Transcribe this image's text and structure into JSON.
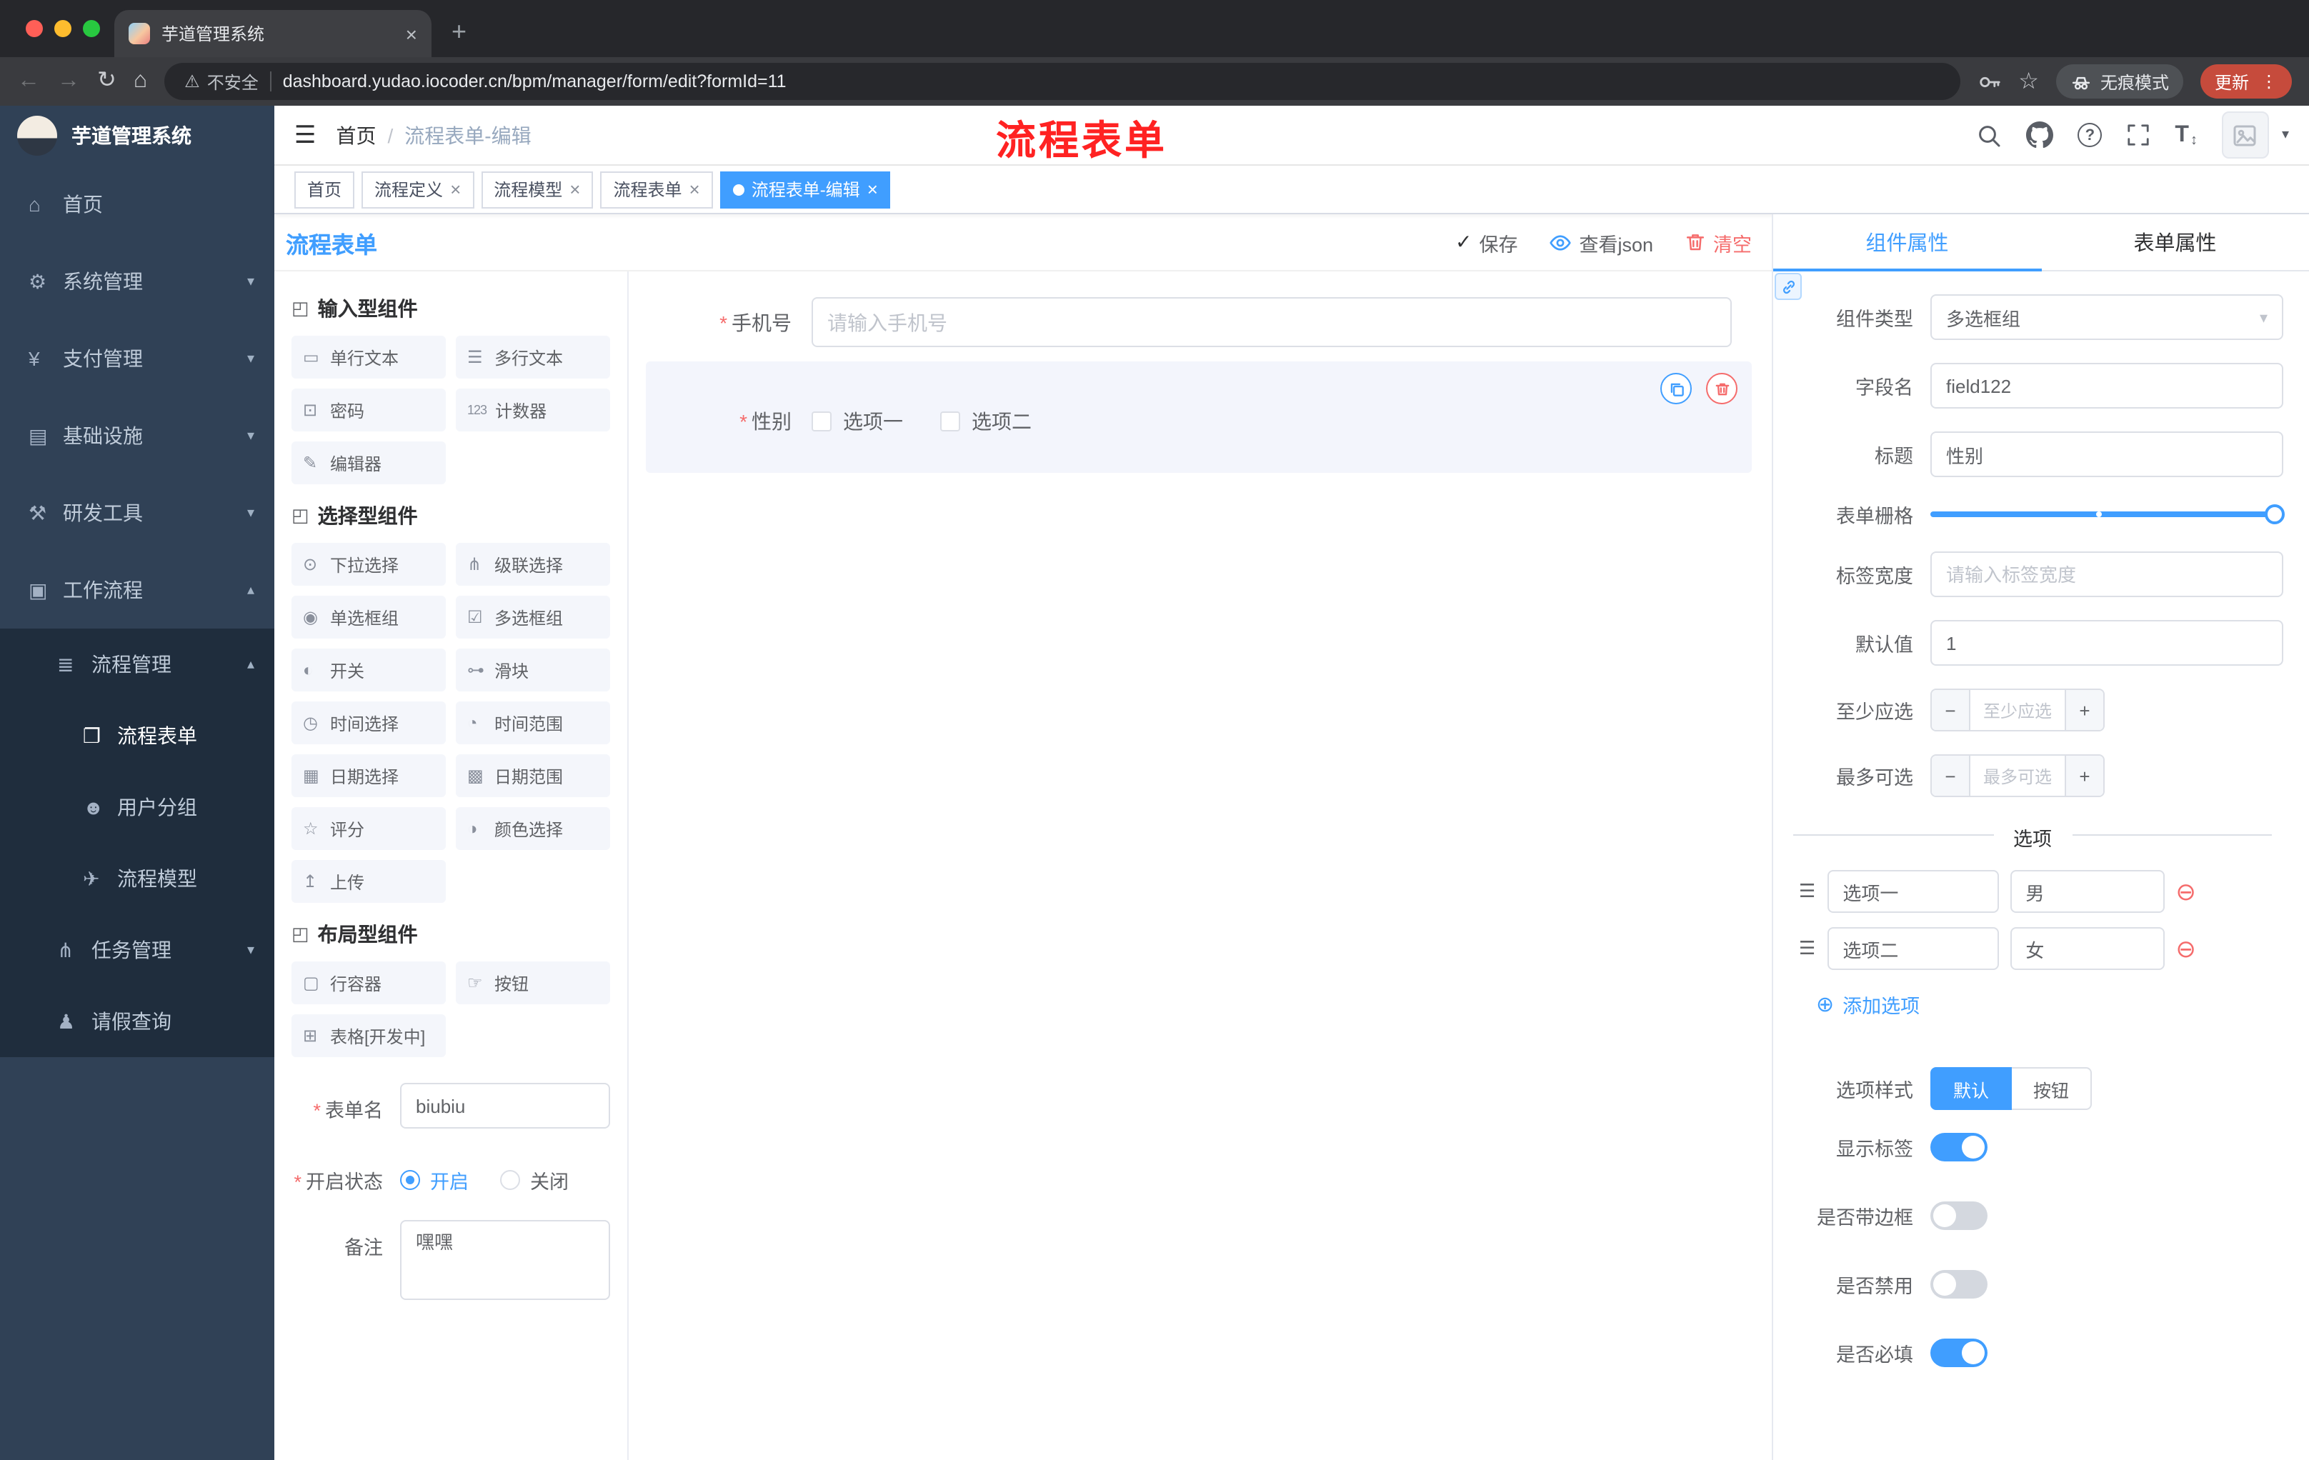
{
  "browser": {
    "tab_title": "芋道管理系统",
    "security_label": "不安全",
    "url": "dashboard.yudao.iocoder.cn/bpm/manager/form/edit?formId=11",
    "incognito_label": "无痕模式",
    "update_label": "更新"
  },
  "icons": {
    "close": "×",
    "plus": "+",
    "minus": "−",
    "back": "←",
    "forward": "→",
    "reload": "↻",
    "home": "⌂",
    "warning": "⚠",
    "star": "☆",
    "dots": "⋮",
    "hamburger": "☰",
    "chevron_down": "▾",
    "caret_down": "▾",
    "check": "✓",
    "question": "?",
    "text_size": "T",
    "text_size_arrows": "↕",
    "group": "◰",
    "required": "*",
    "add_circle": "⊕",
    "remove_circle": "⊖",
    "drag": "☰"
  },
  "sidebar": {
    "logo_title": "芋道管理系统",
    "items": [
      {
        "label": "首页",
        "glyph": "⌂"
      },
      {
        "label": "系统管理",
        "glyph": "⚙",
        "arrow": "▾"
      },
      {
        "label": "支付管理",
        "glyph": "¥",
        "arrow": "▾"
      },
      {
        "label": "基础设施",
        "glyph": "▤",
        "arrow": "▾"
      },
      {
        "label": "研发工具",
        "glyph": "⚒",
        "arrow": "▾"
      },
      {
        "label": "工作流程",
        "glyph": "▣",
        "arrow": "▴"
      },
      {
        "label": "流程管理",
        "glyph": "≣",
        "arrow": "▴"
      },
      {
        "label": "流程表单",
        "glyph": "❐"
      },
      {
        "label": "用户分组",
        "glyph": "☻"
      },
      {
        "label": "流程模型",
        "glyph": "✈"
      },
      {
        "label": "任务管理",
        "glyph": "⋔",
        "arrow": "▾"
      },
      {
        "label": "请假查询",
        "glyph": "♟"
      }
    ]
  },
  "header": {
    "breadcrumb_home": "首页",
    "breadcrumb_sep": "/",
    "breadcrumb_current": "流程表单-编辑",
    "watermark": "流程表单"
  },
  "tags": [
    {
      "label": "首页"
    },
    {
      "label": "流程定义"
    },
    {
      "label": "流程模型"
    },
    {
      "label": "流程表单"
    },
    {
      "label": "流程表单-编辑"
    }
  ],
  "designer": {
    "title": "流程表单",
    "save_label": "保存",
    "view_json_label": "查看json",
    "clear_label": "清空",
    "groups": [
      {
        "title": "输入型组件"
      },
      {
        "title": "选择型组件"
      },
      {
        "title": "布局型组件"
      }
    ],
    "palette1": [
      {
        "label": "单行文本",
        "glyph": "▭"
      },
      {
        "label": "多行文本",
        "glyph": "☰"
      },
      {
        "label": "密码",
        "glyph": "⊡"
      },
      {
        "label": "计数器",
        "glyph": "123"
      },
      {
        "label": "编辑器",
        "glyph": "✎"
      }
    ],
    "palette2": [
      {
        "label": "下拉选择",
        "glyph": "⊙"
      },
      {
        "label": "级联选择",
        "glyph": "⋔"
      },
      {
        "label": "单选框组",
        "glyph": "◉"
      },
      {
        "label": "多选框组",
        "glyph": "☑"
      },
      {
        "label": "开关",
        "glyph": "◐"
      },
      {
        "label": "滑块",
        "glyph": "⊶"
      },
      {
        "label": "时间选择",
        "glyph": "◷"
      },
      {
        "label": "时间范围",
        "glyph": "◔"
      },
      {
        "label": "日期选择",
        "glyph": "▦"
      },
      {
        "label": "日期范围",
        "glyph": "▩"
      },
      {
        "label": "评分",
        "glyph": "☆"
      },
      {
        "label": "颜色选择",
        "glyph": "◑"
      },
      {
        "label": "上传",
        "glyph": "↥"
      }
    ],
    "palette3": [
      {
        "label": "行容器",
        "glyph": "▢"
      },
      {
        "label": "按钮",
        "glyph": "☞"
      },
      {
        "label": "表格[开发中]",
        "glyph": "⊞"
      }
    ],
    "meta": {
      "form_name_label": "表单名",
      "form_name_value": "biubiu",
      "status_label": "开启状态",
      "status_on": "开启",
      "status_off": "关闭",
      "remark_label": "备注",
      "remark_value": "嘿嘿"
    },
    "canvas": {
      "phone_label": "手机号",
      "phone_placeholder": "请输入手机号",
      "gender_label": "性别",
      "gender_opt1": "选项一",
      "gender_opt2": "选项二"
    }
  },
  "props": {
    "tab_component": "组件属性",
    "tab_form": "表单属性",
    "component_type_label": "组件类型",
    "component_type_value": "多选框组",
    "field_name_label": "字段名",
    "field_name_value": "field122",
    "title_label": "标题",
    "title_value": "性别",
    "grid_label": "表单栅格",
    "label_width_label": "标签宽度",
    "label_width_placeholder": "请输入标签宽度",
    "default_label": "默认值",
    "default_value": "1",
    "min_label": "至少应选",
    "min_placeholder": "至少应选",
    "max_label": "最多可选",
    "max_placeholder": "最多可选",
    "options_title": "选项",
    "options": [
      {
        "label": "选项一",
        "value": "男"
      },
      {
        "label": "选项二",
        "value": "女"
      }
    ],
    "add_option_label": "添加选项",
    "style_label": "选项样式",
    "style_default": "默认",
    "style_button": "按钮",
    "switch_show_label": "显示标签",
    "switch_border_label": "是否带边框",
    "switch_disabled_label": "是否禁用",
    "switch_required_label": "是否必填"
  },
  "colors": {
    "accent": "#409EFF",
    "danger": "#F56C6C",
    "watermark_red": "#FF2222",
    "sidebar_bg": "#304156",
    "submenu_bg": "#1F2D3D"
  }
}
